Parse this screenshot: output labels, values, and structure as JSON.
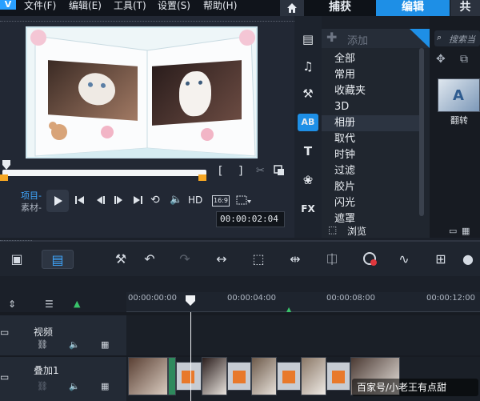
{
  "menu": {
    "logo": "V",
    "items": [
      "文件(F)",
      "编辑(E)",
      "工具(T)",
      "设置(S)",
      "帮助(H)"
    ]
  },
  "tabs": {
    "capture": "捕获",
    "edit": "编辑",
    "share": "共"
  },
  "preview": {
    "project_label": "项目-",
    "clip_label": "素材-",
    "hd_label": "HD",
    "ratio_label": "16:9",
    "timecode": "00:00:02:04"
  },
  "library": {
    "add_label": "添加",
    "search_placeholder": "搜索当",
    "categories": [
      "全部",
      "常用",
      "收藏夹",
      "3D",
      "相册",
      "取代",
      "时钟",
      "过滤",
      "胶片",
      "闪光",
      "遮罩"
    ],
    "selected_category": "相册",
    "browse_label": "浏览",
    "thumb_label": "翻转",
    "fx_label": "FX"
  },
  "timeline": {
    "ticks": [
      "00:00:00:00",
      "00:00:04:00",
      "00:00:08:00",
      "00:00:12:00"
    ],
    "tracks": [
      {
        "name": "视频"
      },
      {
        "name": "叠加1"
      }
    ]
  },
  "watermark": "百家号/小老王有点甜",
  "colors": {
    "accent": "#1e8fe6",
    "panel": "#20262f",
    "bg": "#1b2029",
    "clip_orange": "#e8792b"
  }
}
